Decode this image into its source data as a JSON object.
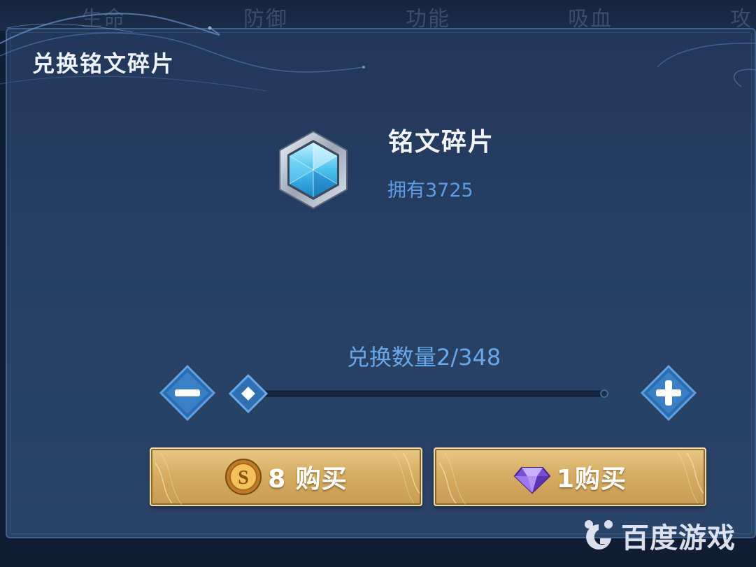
{
  "background_tabs": [
    "生命",
    "防御",
    "功能",
    "吸血",
    "攻"
  ],
  "dialog": {
    "title": "兑换铭文碎片"
  },
  "item": {
    "name": "铭文碎片",
    "owned": "拥有3725",
    "icon": "inscription-fragment-crystal-icon"
  },
  "quantity": {
    "label": "兑换数量2/348",
    "current": 2,
    "max": 348,
    "minus_icon": "minus-icon",
    "plus_icon": "plus-icon"
  },
  "buy_gold": {
    "label": "8 购买",
    "icon": "gold-coin-icon"
  },
  "buy_gem": {
    "label": "1购买",
    "icon": "purple-diamond-icon"
  },
  "watermark": {
    "text": "百度游戏",
    "icon": "baidu-games-logo"
  },
  "colors": {
    "panel": "#263f63",
    "accent_text": "#6aa7ea",
    "gold_button": "#d6ad62"
  }
}
